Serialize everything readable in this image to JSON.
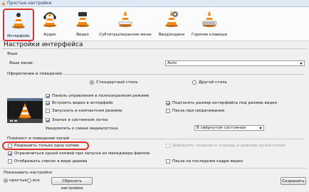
{
  "window": {
    "title": "Простые настройки"
  },
  "toolbar": {
    "items": [
      {
        "label": "Интерфейс",
        "icon": "interface-cone-icon",
        "active": true
      },
      {
        "label": "Аудио",
        "icon": "audio-cone-headphones-icon",
        "active": false
      },
      {
        "label": "Видео",
        "icon": "video-cone-icon",
        "active": false
      },
      {
        "label": "Субтитры/экранное меню",
        "icon": "subtitles-cone-icon",
        "active": false
      },
      {
        "label": "Ввод/кодеки",
        "icon": "codecs-cone-icon",
        "active": false
      },
      {
        "label": "Горячие клавиши",
        "icon": "hotkeys-cone-icon",
        "active": false
      }
    ]
  },
  "page": {
    "heading": "Настройки интерфейса"
  },
  "language": {
    "section_label": "Язык",
    "menu_language_label": "Язык меню:",
    "menu_language_value": "Auto"
  },
  "look": {
    "section_label": "Оформление и поведение",
    "style_native": "Стандартный стиль",
    "style_native_selected": true,
    "style_other": "Другой стиль",
    "style_other_selected": false,
    "options_left": [
      {
        "label": "Панель управления в полноэкранном режиме",
        "checked": true
      },
      {
        "label": "Встроить видео в интерфейс",
        "checked": true
      },
      {
        "label": "Запускать в компактном режиме",
        "checked": false
      },
      {
        "label": "Значок в системном лотке",
        "checked": true
      }
    ],
    "options_right": [
      {
        "label": "Подгонять размер интерфейса под размер видео",
        "checked": true
      },
      {
        "label": "Пауза при сворачивании",
        "checked": false
      }
    ],
    "notify_label": "Уведомлять о смене медиапотока:",
    "notify_value": "В свёрнутом состоянии"
  },
  "playlist": {
    "section_label": "Плейлист и поведение копий",
    "options": [
      {
        "label": "Разрешить только одну копию",
        "checked": false,
        "disabled": false
      },
      {
        "label": "Ограничиться одной копией при запуске из менеджера файлов",
        "checked": true,
        "disabled": false
      },
      {
        "label": "Отображать список в виде дерева",
        "checked": false,
        "disabled": false
      }
    ],
    "options_right": [
      {
        "label": "Добавлять позиции в очередь в режиме одной копии",
        "checked": false,
        "disabled": true
      },
      {
        "label": "Пауза на последнем кадре видео",
        "checked": false,
        "disabled": false
      }
    ]
  },
  "footer": {
    "show_settings_label": "Показывать настройки",
    "radio_simple": "простые",
    "radio_simple_selected": true,
    "radio_all": "все",
    "radio_all_selected": false,
    "reset_button": "Сбросить настройки",
    "save_button": "Сохранить"
  },
  "colors": {
    "highlight": "#e0302a",
    "cone_orange": "#f28a1a",
    "accent_blue": "#1b3f8f"
  }
}
